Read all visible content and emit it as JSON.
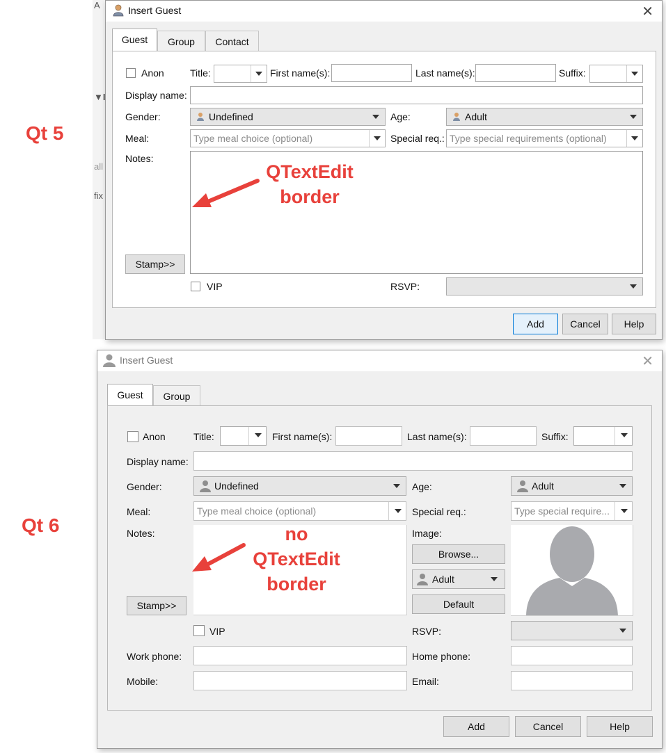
{
  "labels": {
    "qt5": "Qt 5",
    "qt6": "Qt 6"
  },
  "background_app": {
    "fragments": [
      "A",
      "▼I",
      "all",
      "fix"
    ]
  },
  "qt5": {
    "title": "Insert Guest",
    "tabs": [
      "Guest",
      "Group",
      "Contact"
    ],
    "anon_label": "Anon",
    "title_label": "Title:",
    "first_name_label": "First name(s):",
    "last_name_label": "Last name(s):",
    "suffix_label": "Suffix:",
    "display_name_label": "Display name:",
    "gender_label": "Gender:",
    "gender_value": "Undefined",
    "age_label": "Age:",
    "age_value": "Adult",
    "meal_label": "Meal:",
    "meal_placeholder": "Type meal choice (optional)",
    "special_req_label": "Special req.:",
    "special_req_placeholder": "Type special requirements (optional)",
    "notes_label": "Notes:",
    "stamp_button": "Stamp>>",
    "vip_label": "VIP",
    "rsvp_label": "RSVP:",
    "add_button": "Add",
    "cancel_button": "Cancel",
    "help_button": "Help",
    "annotation": [
      "QTextEdit",
      "border"
    ]
  },
  "qt6": {
    "title": "Insert Guest",
    "tabs": [
      "Guest",
      "Group"
    ],
    "anon_label": "Anon",
    "title_label": "Title:",
    "first_name_label": "First name(s):",
    "last_name_label": "Last name(s):",
    "suffix_label": "Suffix:",
    "display_name_label": "Display name:",
    "gender_label": "Gender:",
    "gender_value": "Undefined",
    "age_label": "Age:",
    "age_value": "Adult",
    "meal_label": "Meal:",
    "meal_placeholder": "Type meal choice (optional)",
    "special_req_label": "Special req.:",
    "special_req_placeholder": "Type special require...",
    "notes_label": "Notes:",
    "image_label": "Image:",
    "browse_button": "Browse...",
    "image_age_value": "Adult",
    "default_button": "Default",
    "stamp_button": "Stamp>>",
    "vip_label": "VIP",
    "rsvp_label": "RSVP:",
    "work_phone_label": "Work phone:",
    "home_phone_label": "Home phone:",
    "mobile_label": "Mobile:",
    "email_label": "Email:",
    "add_button": "Add",
    "cancel_button": "Cancel",
    "help_button": "Help",
    "annotation": [
      "no",
      "QTextEdit",
      "border"
    ]
  },
  "colors": {
    "annotation_red": "#e8413b",
    "focus_blue": "#0078d7"
  }
}
